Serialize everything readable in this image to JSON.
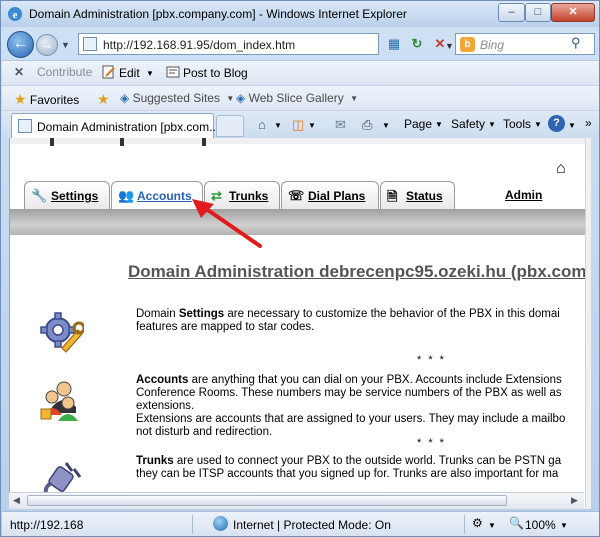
{
  "window": {
    "title": "Domain Administration [pbx.company.com] - Windows Internet Explorer",
    "min_glyph": "–",
    "max_glyph": "□",
    "close_glyph": "✕"
  },
  "address_bar": {
    "url": "http://192.168.91.95/dom_index.htm",
    "search_placeholder": "Bing"
  },
  "command_bar": {
    "close_glyph": "✕",
    "contribute": "Contribute",
    "edit": "Edit",
    "post_to_blog": "Post to Blog"
  },
  "favorites_bar": {
    "favorites": "Favorites",
    "suggested_sites": "Suggested Sites",
    "web_slice_gallery": "Web Slice Gallery"
  },
  "browser_tabs": {
    "active_tab": "Domain Administration [pbx.com...",
    "page": "Page",
    "safety": "Safety",
    "tools": "Tools",
    "help_glyph": "?"
  },
  "app": {
    "tabs": [
      {
        "label": "Settings"
      },
      {
        "label": "Accounts"
      },
      {
        "label": "Trunks"
      },
      {
        "label": "Dial Plans"
      },
      {
        "label": "Status"
      }
    ],
    "admin": "Admin",
    "heading": "Domain Administration debrecenpc95.ozeki.hu (pbx.com",
    "separator": "* * *",
    "settings_section": {
      "line1_pre": "Domain ",
      "line1_bold": "Settings",
      "line1_post": " are necessary to customize the behavior of the PBX in this domai",
      "line2": "features are mapped to star codes."
    },
    "accounts_section": {
      "line1_bold": "Accounts",
      "line1_post": " are anything that you can dial on your PBX. Accounts include Extensions",
      "line2": "Conference Rooms. These numbers may be service numbers of the PBX as well as",
      "line3": "extensions.",
      "line4": "Extensions are accounts that are assigned to your users. They may include a mailbo",
      "line5": "not disturb and redirection."
    },
    "trunks_section": {
      "line1_bold": "Trunks",
      "line1_post": " are used to connect your PBX to the outside world. Trunks can be PSTN ga",
      "line2": "they can be ITSP accounts that you signed up for. Trunks are also important for ma"
    }
  },
  "status_bar": {
    "url": "http://192.168",
    "zone": "Internet | Protected Mode: On",
    "zoom": "100%"
  }
}
